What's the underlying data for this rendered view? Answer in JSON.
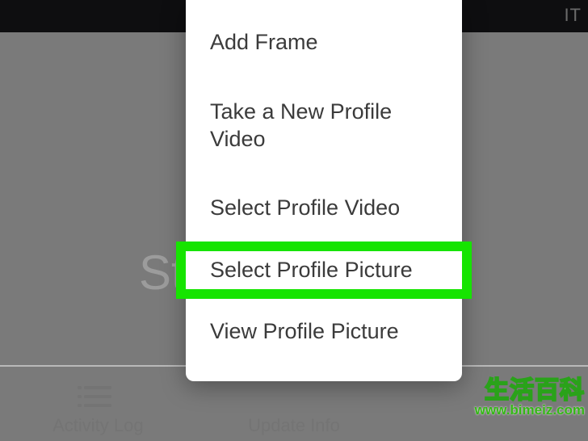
{
  "topbar": {
    "edit": "IT"
  },
  "profile": {
    "name_fragment": "St"
  },
  "tabs": {
    "activity": {
      "label": "Activity Log"
    },
    "update": {
      "label": "Update Info"
    }
  },
  "menu": {
    "items": [
      {
        "label": "Add Frame"
      },
      {
        "label": "Take a New Profile Video"
      },
      {
        "label": "Select Profile Video"
      },
      {
        "label": "Select Profile Picture"
      },
      {
        "label": "View Profile Picture"
      }
    ],
    "highlighted_index": 3,
    "highlight_color": "#16e400"
  },
  "watermark": {
    "cn": "生活百科",
    "url": "www.bimeiz.com"
  }
}
